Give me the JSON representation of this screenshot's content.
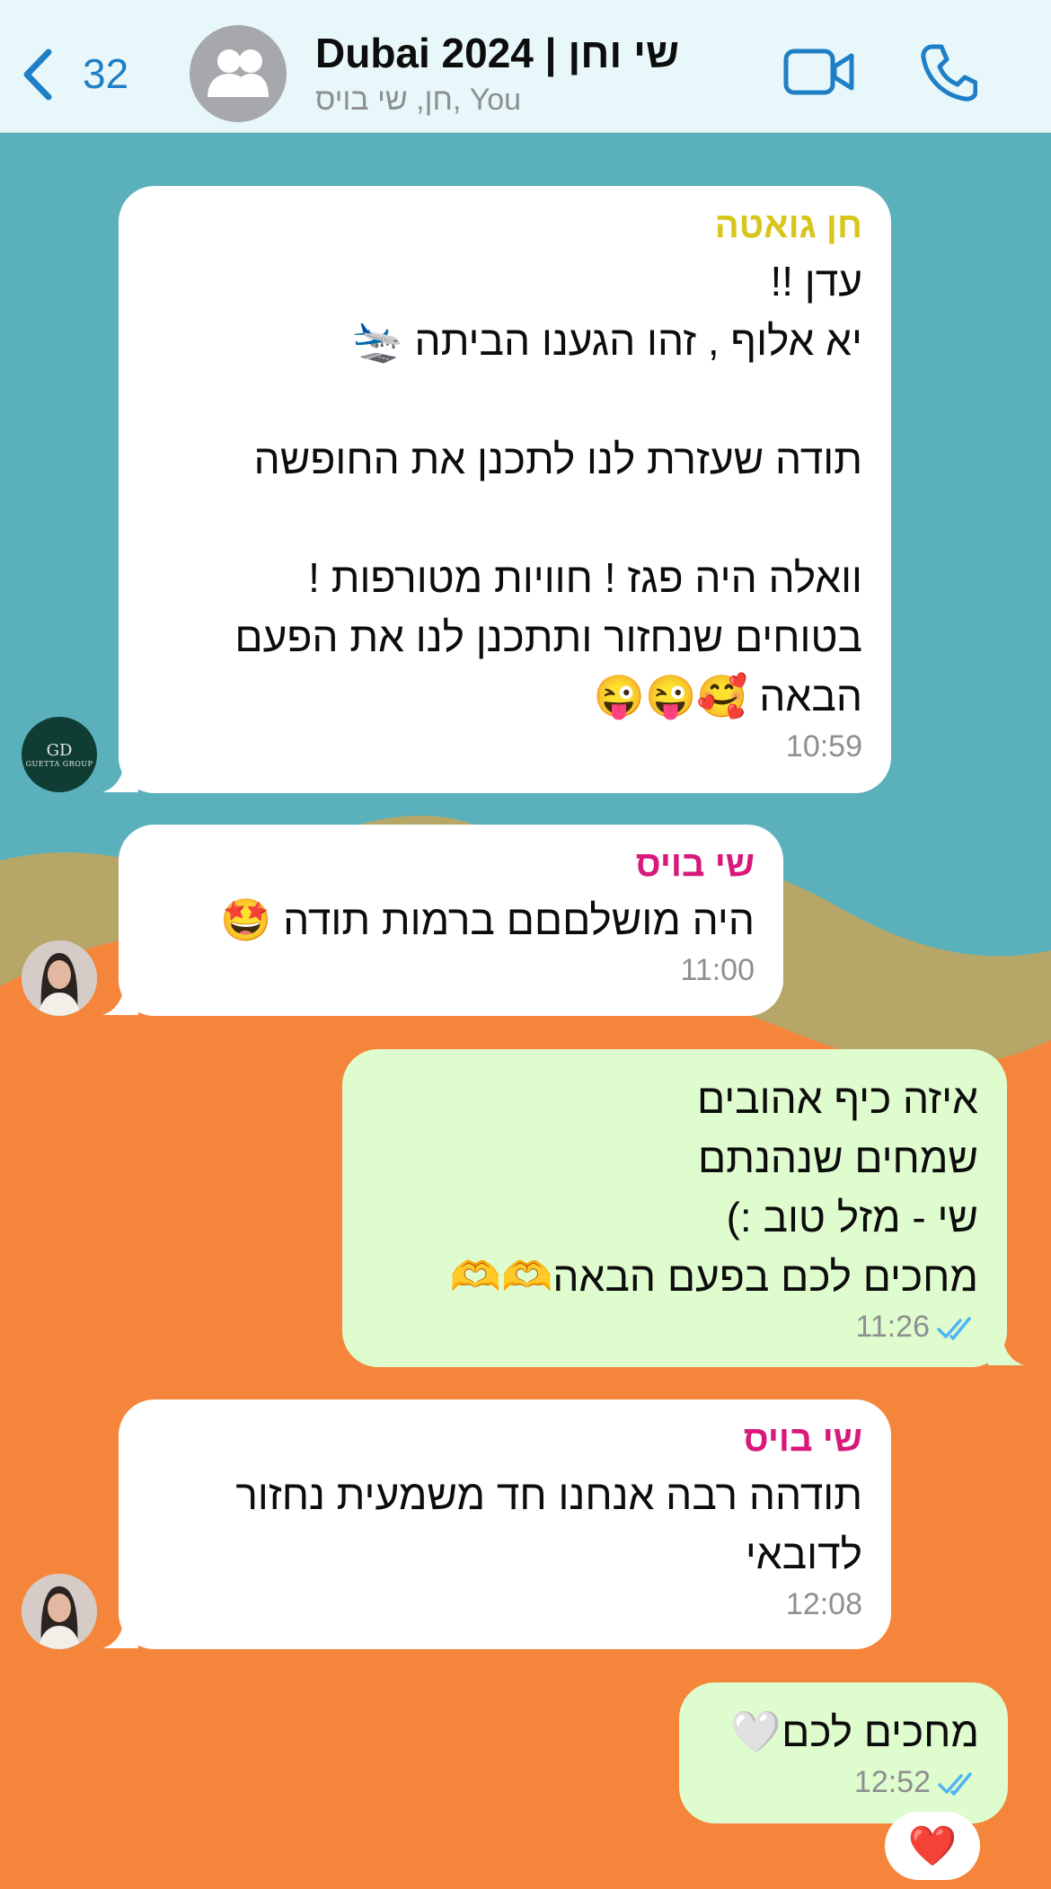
{
  "header": {
    "back_count": "32",
    "title": "Dubai 2024 | שי וחן",
    "subtitle": "חן, שי בויס, You"
  },
  "colors": {
    "header_bg": "#e8f7f9",
    "accent": "#1f7fc6",
    "incoming_bubble": "#ffffff",
    "outgoing_bubble": "#dffcce",
    "sender_chen": "#d8c61a",
    "sender_shai": "#d8187a",
    "read_ticks": "#4fb4f4"
  },
  "avatars": {
    "chen_logo_mark": "GD",
    "chen_logo_name": "GUETTA GROUP"
  },
  "messages": [
    {
      "sender": "חן גואטה",
      "text": "עדן !!\nיא אלוף , זהו הגענו הביתה 🛬\n\nתודה שעזרת לנו לתכנן את החופשה\n\nוואלה היה פגז ! חוויות מטורפות !\nבטוחים שנחזור ותתכנן לנו את הפעם הבאה 🥰😜😜",
      "time": "10:59"
    },
    {
      "sender": "שי בויס",
      "text": "היה מושלםםם ברמות תודה 🤩",
      "time": "11:00"
    },
    {
      "text": "איזה כיף אהובים\nשמחים שנהנתם\nשי - מזל טוב :)\nמחכים לכם בפעם הבאה🫶🫶",
      "time": "11:26"
    },
    {
      "sender": "שי בויס",
      "text": "תודהה רבה אנחנו חד משמעית נחזור לדובאי",
      "time": "12:08"
    },
    {
      "text": "מחכים לכם🤍",
      "time": "12:52",
      "reaction": "❤️"
    }
  ]
}
